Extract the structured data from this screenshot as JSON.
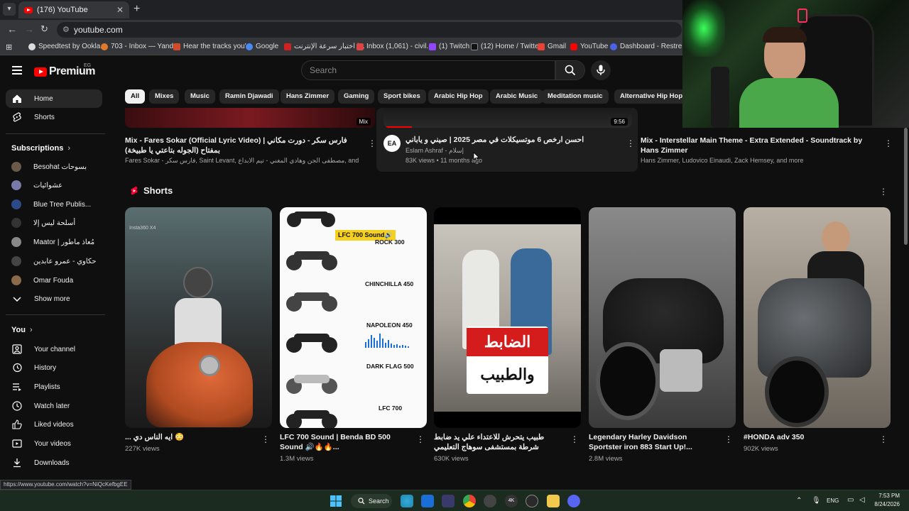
{
  "browser": {
    "tab_title": "(176) YouTube",
    "url": "youtube.com",
    "bookmarks": [
      {
        "label": "Speedtest by Ookla..."
      },
      {
        "label": "703 - Inbox — Yand..."
      },
      {
        "label": "Hear the tracks you'..."
      },
      {
        "label": "Google"
      },
      {
        "label": "اختبار سرعة الإنترنت |..."
      },
      {
        "label": "Inbox (1,061) - civil..."
      },
      {
        "label": "(1) Twitch"
      },
      {
        "label": "(12) Home / Twitter"
      },
      {
        "label": "Gmail"
      },
      {
        "label": "YouTube"
      },
      {
        "label": "Dashboard - Restre..."
      }
    ],
    "status_url": "https://www.youtube.com/watch?v=NiQcKefbgEE"
  },
  "header": {
    "logo_text": "Premium",
    "country": "EG",
    "search_placeholder": "Search"
  },
  "sidebar": {
    "main": [
      {
        "label": "Home",
        "icon": "home-icon"
      },
      {
        "label": "Shorts",
        "icon": "shorts-icon"
      }
    ],
    "subscriptions_title": "Subscriptions",
    "subscriptions": [
      {
        "label": "Besohat بسوحات",
        "color": "#6b5a4a"
      },
      {
        "label": "عشوائيات",
        "color": "#7a7aa8"
      },
      {
        "label": "Blue Tree Publis...",
        "color": "#2c4a8a"
      },
      {
        "label": "أسلحة ليس إلا",
        "color": "#333333"
      },
      {
        "label": "Maator | مُعاذ ماطور",
        "color": "#888888"
      },
      {
        "label": "حكاوي - عمرو عابدين",
        "color": "#444444"
      },
      {
        "label": "Omar Fouda",
        "color": "#8a6a4a"
      }
    ],
    "show_more": "Show more",
    "you_title": "You",
    "you_items": [
      {
        "label": "Your channel",
        "icon": "channel-icon"
      },
      {
        "label": "History",
        "icon": "history-icon"
      },
      {
        "label": "Playlists",
        "icon": "playlists-icon"
      },
      {
        "label": "Watch later",
        "icon": "clock-icon"
      },
      {
        "label": "Liked videos",
        "icon": "thumbs-up-icon"
      },
      {
        "label": "Your videos",
        "icon": "video-icon"
      },
      {
        "label": "Downloads",
        "icon": "download-icon"
      }
    ]
  },
  "chips": [
    "All",
    "Mixes",
    "Music",
    "Ramin Djawadi",
    "Hans Zimmer",
    "Gaming",
    "Sport bikes",
    "Arabic Hip Hop",
    "Arabic Music",
    "Meditation music",
    "Alternative Hip Hop"
  ],
  "videos": [
    {
      "title": "Mix - Fares Sokar (Official Lyric Video) | فارس سكر - دورت مكاني بمفتاح (الجوله بتاعتي يا طبيخة)",
      "meta": "Fares Sokar - فارس سكر, Saint Levant, مصطفى الجن وهادي المغني - تيم الابداع, and more",
      "badge": "Mix"
    },
    {
      "title": "احسن ارخص 6 موتسيكلات في مصر 2025 | صيني و ياباني",
      "channel": "Eslam Ashraf - إسلام",
      "stats": "83K views • 11 months ago",
      "duration": "9:56"
    },
    {
      "title": "Mix - Interstellar Main Theme - Extra Extended - Soundtrack by Hans Zimmer",
      "meta": "Hans Zimmer, Ludovico Einaudi, Zack Hemsey, and more"
    }
  ],
  "shorts_title": "Shorts",
  "shorts": [
    {
      "title": "... ايه الناس دي 😳",
      "views": "227K views",
      "overlay": "Insta360 X4"
    },
    {
      "title": "LFC 700 Sound | Benda BD 500 Sound 🔊🔥🔥...",
      "views": "1.3M views",
      "labels": [
        "LFC 700 Sound🔊",
        "ROCK 300",
        "CHINCHILLA 450",
        "NAPOLEON 450",
        "DARK FLAG 500",
        "LFC 700"
      ]
    },
    {
      "title": "طبيب يتحرش للاعتداء علي يد ضابط شرطة بمستشفى سوهاج التعليمي",
      "views": "630K views",
      "overlay_lines": [
        "الضابط",
        "والطبيب"
      ]
    },
    {
      "title": "Legendary Harley Davidson Sportster iron 883 Start Up!...",
      "views": "2.8M views"
    },
    {
      "title": "#HONDA adv 350",
      "views": "902K views"
    }
  ],
  "taskbar": {
    "search_label": "Search",
    "lang": "ENG",
    "time": "7:53 PM",
    "date": "8/24/2026"
  },
  "colors": {
    "accent": "#ff0000",
    "bg": "#0f0f0f",
    "chip": "#272727"
  }
}
